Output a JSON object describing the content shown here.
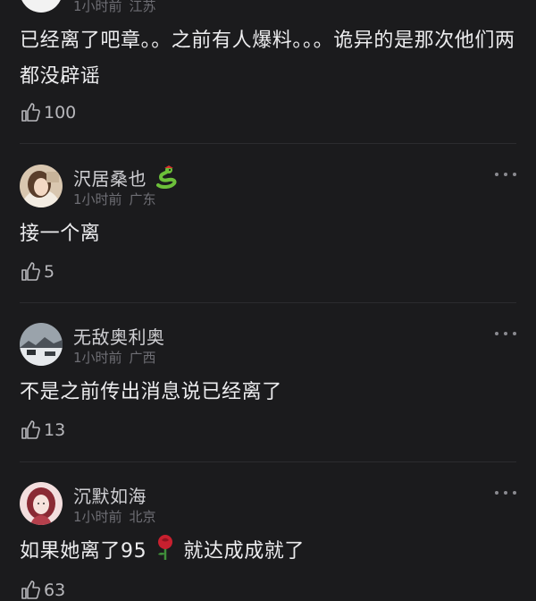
{
  "comments": [
    {
      "username": "",
      "time": "1小时前",
      "location": "江苏",
      "text": "已经离了吧章。。之前有人爆料。。。诡异的是那次他们两都没辟谣",
      "likes": "100",
      "avatar_icon": "profile-photo"
    },
    {
      "username": "沢居桑也",
      "username_emoji": "snake-emoji",
      "time": "1小时前",
      "location": "广东",
      "text": "接一个离",
      "likes": "5",
      "avatar_icon": "girl-portrait"
    },
    {
      "username": "无敌奥利奥",
      "time": "1小时前",
      "location": "广西",
      "text": "不是之前传出消息说已经离了",
      "likes": "13",
      "avatar_icon": "snowy-landscape"
    },
    {
      "username": "沉默如海",
      "time": "1小时前",
      "location": "北京",
      "text_before_emoji": "如果她离了95",
      "text_emoji": "rose-emoji",
      "text_after_emoji": "就达成成就了",
      "likes": "63",
      "avatar_icon": "illustrated-woman"
    }
  ],
  "colors": {
    "background": "#1b1b1d",
    "text": "#ececee",
    "meta": "#6e6e74",
    "username": "#cfcfd3"
  },
  "icons": {
    "like": "thumbs-up-icon",
    "more": "more-dots-icon"
  }
}
